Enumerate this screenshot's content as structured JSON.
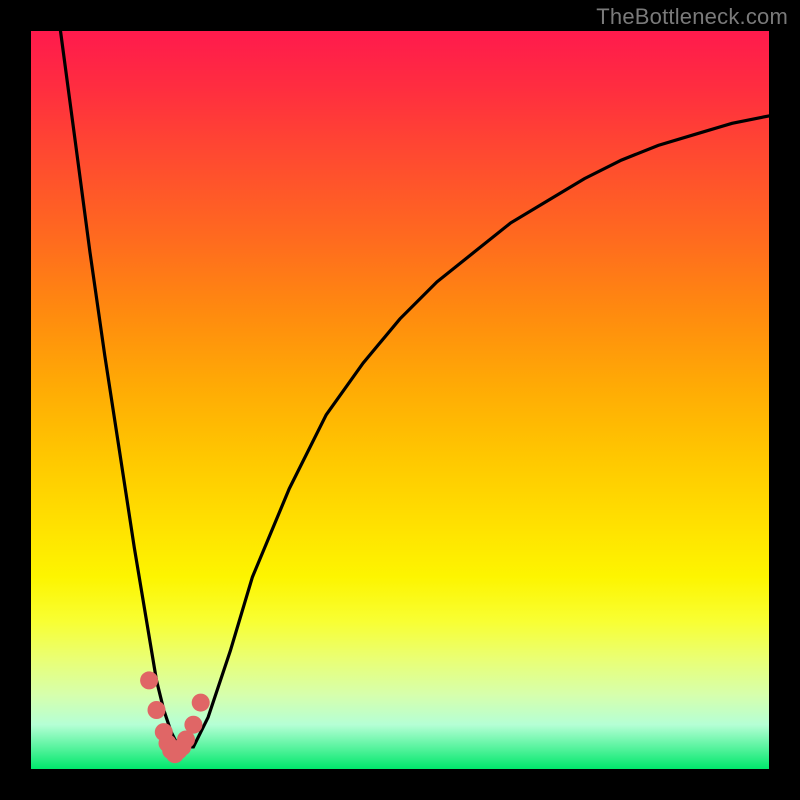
{
  "watermark": "TheBottleneck.com",
  "colors": {
    "frame": "#000000",
    "curve": "#000000",
    "marker": "#e06666"
  },
  "chart_data": {
    "type": "line",
    "title": "",
    "xlabel": "",
    "ylabel": "",
    "xlim": [
      0,
      100
    ],
    "ylim": [
      0,
      100
    ],
    "grid": false,
    "legend": false,
    "series": [
      {
        "name": "bottleneck-curve",
        "x": [
          4,
          6,
          8,
          10,
          12,
          14,
          15,
          16,
          17,
          18,
          19,
          20,
          22,
          24,
          27,
          30,
          35,
          40,
          45,
          50,
          55,
          60,
          65,
          70,
          75,
          80,
          85,
          90,
          95,
          100
        ],
        "values": [
          100,
          85,
          70,
          56,
          43,
          30,
          24,
          18,
          12,
          8,
          5,
          3,
          3,
          7,
          16,
          26,
          38,
          48,
          55,
          61,
          66,
          70,
          74,
          77,
          80,
          82.5,
          84.5,
          86,
          87.5,
          88.5
        ]
      }
    ],
    "markers": {
      "name": "highlighted-region",
      "x": [
        16,
        17,
        18,
        18.5,
        19,
        19.5,
        20,
        20.5,
        21,
        22,
        23
      ],
      "values": [
        12,
        8,
        5,
        3.5,
        2.5,
        2,
        2.5,
        3,
        4,
        6,
        9
      ]
    }
  }
}
